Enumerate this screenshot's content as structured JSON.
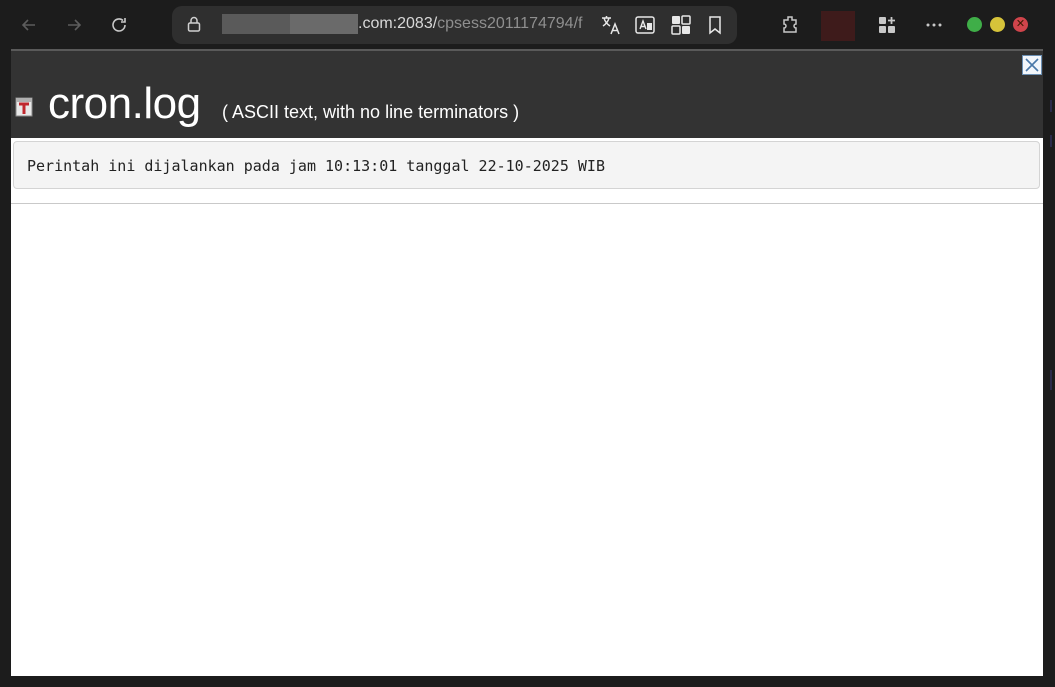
{
  "browser": {
    "url_host": ".com:2083/",
    "url_path": "cpsess2011174794/f",
    "icons": {
      "back": "back-arrow-icon",
      "forward": "forward-arrow-icon",
      "reload": "reload-icon",
      "lock": "lock-icon",
      "translate": "translate-icon",
      "read_aloud": "immersive-reader-icon",
      "split_screen": "split-screen-icon",
      "favorite": "bookmark-icon",
      "extensions": "extensions-icon",
      "apps": "apps-icon",
      "more": "more-icon"
    },
    "window_controls": {
      "minimize_color": "#3fae48",
      "maximize_color": "#d6c33a",
      "close_color": "#d0444b",
      "close_glyph": "✕"
    }
  },
  "page": {
    "file_name": "cron.log",
    "file_type": "( ASCII text, with no line terminators )",
    "log_content": "Perintah ini dijalankan pada jam 10:13:01 tanggal 22-10-2025 WIB",
    "header_color": "#333333"
  }
}
